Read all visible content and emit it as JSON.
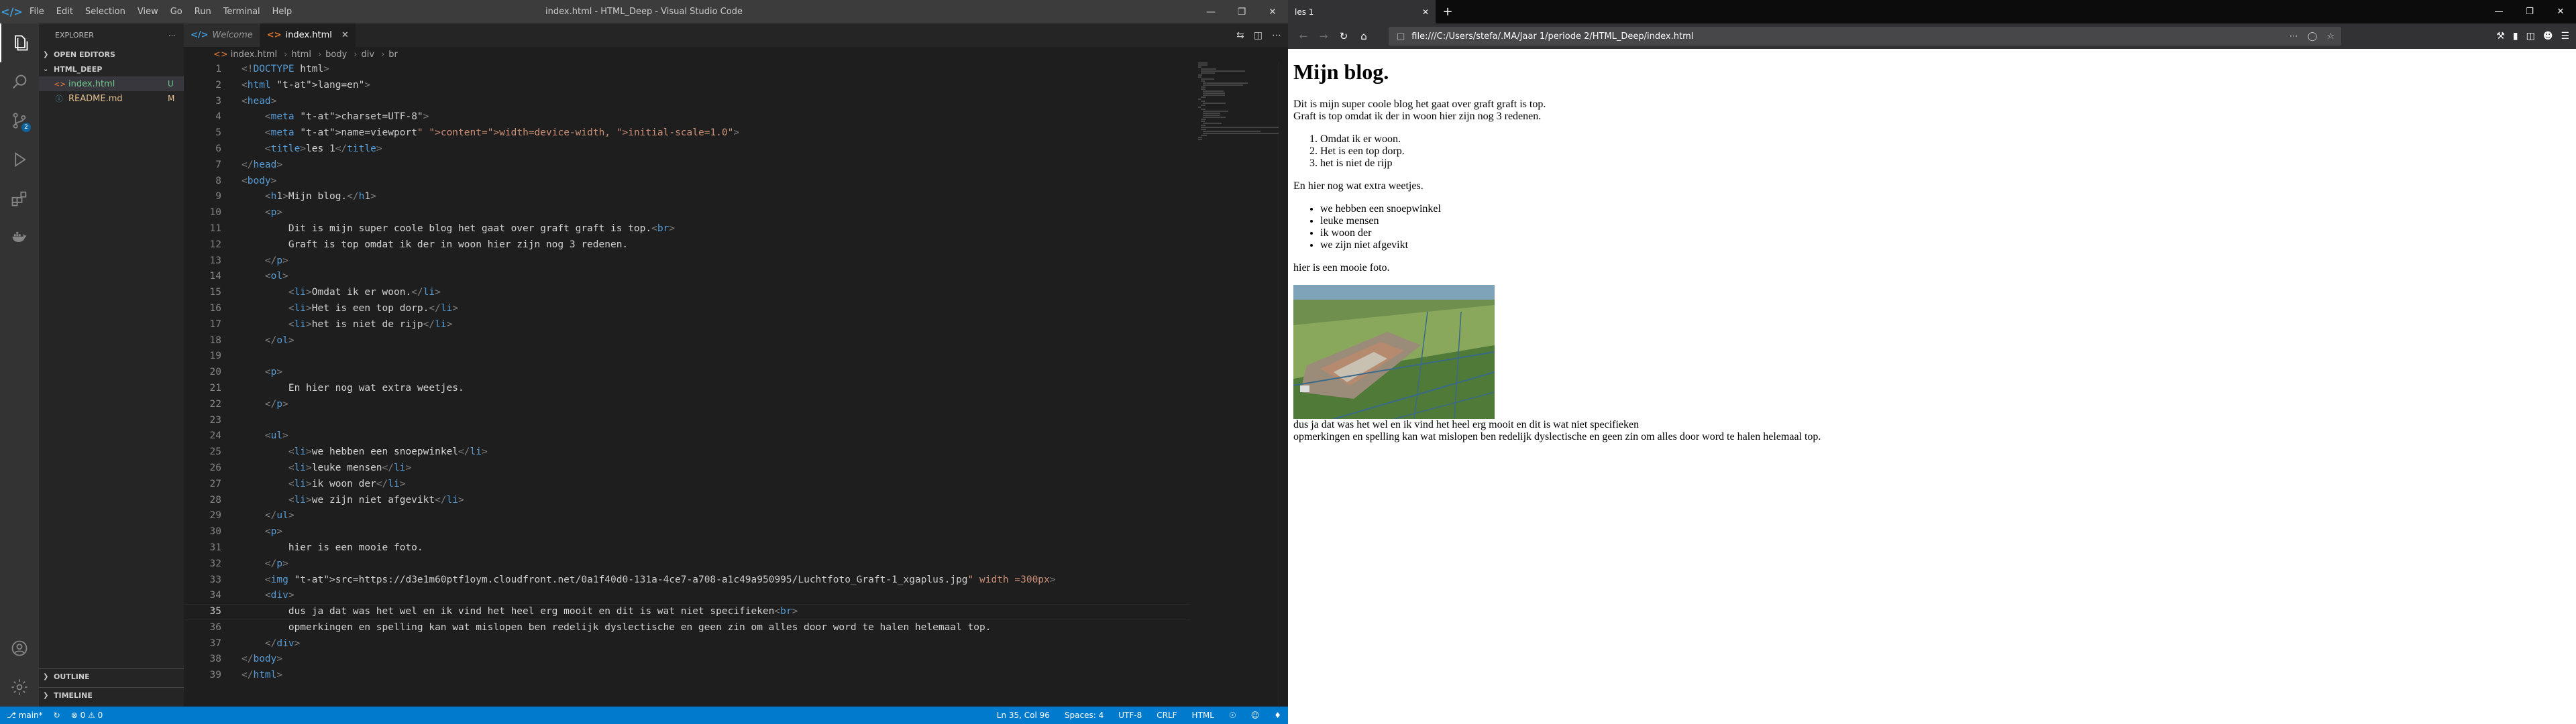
{
  "vscode": {
    "menu": [
      "File",
      "Edit",
      "Selection",
      "View",
      "Go",
      "Run",
      "Terminal",
      "Help"
    ],
    "window_title": "index.html - HTML_Deep - Visual Studio Code",
    "sidebar": {
      "header": "EXPLORER",
      "open_editors": "OPEN EDITORS",
      "folder": "HTML_DEEP",
      "files": [
        {
          "name": "index.html",
          "status": "U",
          "color": "#73c991"
        },
        {
          "name": "README.md",
          "status": "M",
          "color": "#e2c08d"
        }
      ],
      "outline": "OUTLINE",
      "timeline": "TIMELINE"
    },
    "source_control_badge": "2",
    "tabs": [
      {
        "label": "Welcome"
      },
      {
        "label": "index.html"
      }
    ],
    "breadcrumb": [
      "index.html",
      "html",
      "body",
      "div",
      "br"
    ],
    "code_lines": [
      "<!DOCTYPE html>",
      "<html lang=\"en\">",
      "<head>",
      "    <meta charset=\"UTF-8\">",
      "    <meta name=\"viewport\" content=\"width=device-width, initial-scale=1.0\">",
      "    <title>les 1</title>",
      "</head>",
      "<body>",
      "    <h1>Mijn blog.</h1>",
      "    <p>",
      "        Dit is mijn super coole blog het gaat over graft graft is top.<br>",
      "        Graft is top omdat ik der in woon hier zijn nog 3 redenen.",
      "    </p>",
      "    <ol>",
      "        <li>Omdat ik er woon.</li>",
      "        <li>Het is een top dorp.</li>",
      "        <li>het is niet de rijp</li>",
      "    </ol>",
      "",
      "    <p>",
      "        En hier nog wat extra weetjes.",
      "    </p>",
      "",
      "    <ul>",
      "        <li>we hebben een snoepwinkel</li>",
      "        <li>leuke mensen</li>",
      "        <li>ik woon der</li>",
      "        <li>we zijn niet afgevikt</li>",
      "    </ul>",
      "    <p>",
      "        hier is een mooie foto.",
      "    </p>",
      "    <img src=\"https://d3e1m60ptf1oym.cloudfront.net/0a1f40d0-131a-4ce7-a708-a1c49a950995/Luchtfoto_Graft-1_xgaplus.jpg\" width =300px>",
      "    <div>",
      "        dus ja dat was het wel en ik vind het heel erg mooit en dit is wat niet specifieken<br>",
      "        opmerkingen en spelling kan wat mislopen ben redelijk dyslectische en geen zin om alles door word te halen helemaal top.",
      "    </div>",
      "</body>",
      "</html>"
    ],
    "current_line": 35,
    "status": {
      "branch": "main*",
      "errors": "0",
      "warnings": "0",
      "position": "Ln 35, Col 96",
      "spaces": "Spaces: 4",
      "encoding": "UTF-8",
      "eol": "CRLF",
      "language": "HTML"
    }
  },
  "firefox": {
    "tab_title": "les 1",
    "url": "file:///C:/Users/stefa/.MA/Jaar 1/periode 2/HTML_Deep/index.html",
    "page": {
      "h1": "Mijn blog.",
      "p1_line1": "Dit is mijn super coole blog het gaat over graft graft is top.",
      "p1_line2": "Graft is top omdat ik der in woon hier zijn nog 3 redenen.",
      "ol": [
        "Omdat ik er woon.",
        "Het is een top dorp.",
        "het is niet de rijp"
      ],
      "p2": "En hier nog wat extra weetjes.",
      "ul": [
        "we hebben een snoepwinkel",
        "leuke mensen",
        "ik woon der",
        "we zijn niet afgevikt"
      ],
      "p3": "hier is een mooie foto.",
      "after_line1": "dus ja dat was het wel en ik vind het heel erg mooit en dit is wat niet specifieken",
      "after_line2": "opmerkingen en spelling kan wat mislopen ben redelijk dyslectische en geen zin om alles door word te halen helemaal top."
    }
  }
}
